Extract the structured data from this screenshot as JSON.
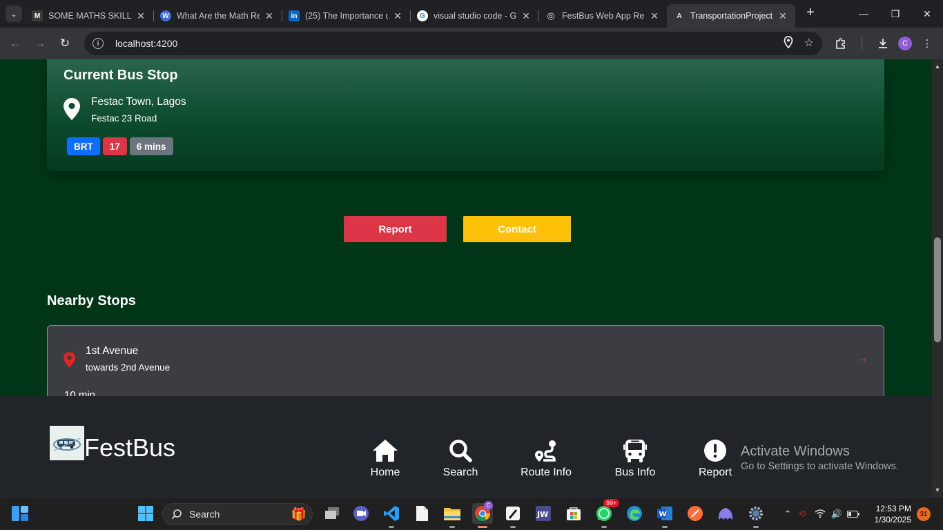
{
  "browser": {
    "tabs": [
      {
        "title": "SOME MATHS SKILLS",
        "favicon": "M",
        "favicon_color": "#3b3b3b"
      },
      {
        "title": "What Are the Math Re",
        "favicon": "W",
        "favicon_color": "#3d6fe0"
      },
      {
        "title": "(25) The Importance o",
        "favicon": "in",
        "favicon_color": "#0a66c2"
      },
      {
        "title": "visual studio code - G",
        "favicon": "G",
        "favicon_color": "#4285f4"
      },
      {
        "title": "FestBus Web App Rep",
        "favicon": "◎",
        "favicon_color": "#444444"
      },
      {
        "title": "TransportationProject",
        "favicon": "A",
        "favicon_color": "#1a1a1a",
        "active": true
      }
    ],
    "url": "localhost:4200",
    "profile_initial": "C"
  },
  "current_stop": {
    "heading": "Current Bus Stop",
    "name": "Festac Town, Lagos",
    "road": "Festac 23 Road",
    "badges": [
      {
        "label": "BRT",
        "color": "#0d6efd"
      },
      {
        "label": "17",
        "color": "#dc3545"
      },
      {
        "label": "6 mins",
        "color": "#6c757d"
      }
    ]
  },
  "actions": {
    "report_label": "Report",
    "contact_label": "Contact"
  },
  "nearby": {
    "heading": "Nearby Stops",
    "stops": [
      {
        "name": "1st Avenue",
        "direction": "towards 2nd Avenue",
        "time": "10 min"
      }
    ]
  },
  "bottom_nav": {
    "brand": "FestBus",
    "items": [
      {
        "label": "Home",
        "icon": "home-icon"
      },
      {
        "label": "Search",
        "icon": "search-icon"
      },
      {
        "label": "Route Info",
        "icon": "route-icon"
      },
      {
        "label": "Bus Info",
        "icon": "bus-icon"
      },
      {
        "label": "Report",
        "icon": "exclamation-circle-icon"
      }
    ]
  },
  "watermark": {
    "title": "Activate Windows",
    "subtitle": "Go to Settings to activate Windows."
  },
  "taskbar": {
    "search_label": "Search",
    "whatsapp_badge": "99+",
    "chrome_badge": "C",
    "time": "12:53 PM",
    "date": "1/30/2025",
    "notification_count": "31"
  },
  "colors": {
    "page_background": "#003617",
    "report_button": "#dc3545",
    "contact_button": "#ffc107",
    "nav_background": "#212529",
    "pin_red": "#e0261d"
  }
}
